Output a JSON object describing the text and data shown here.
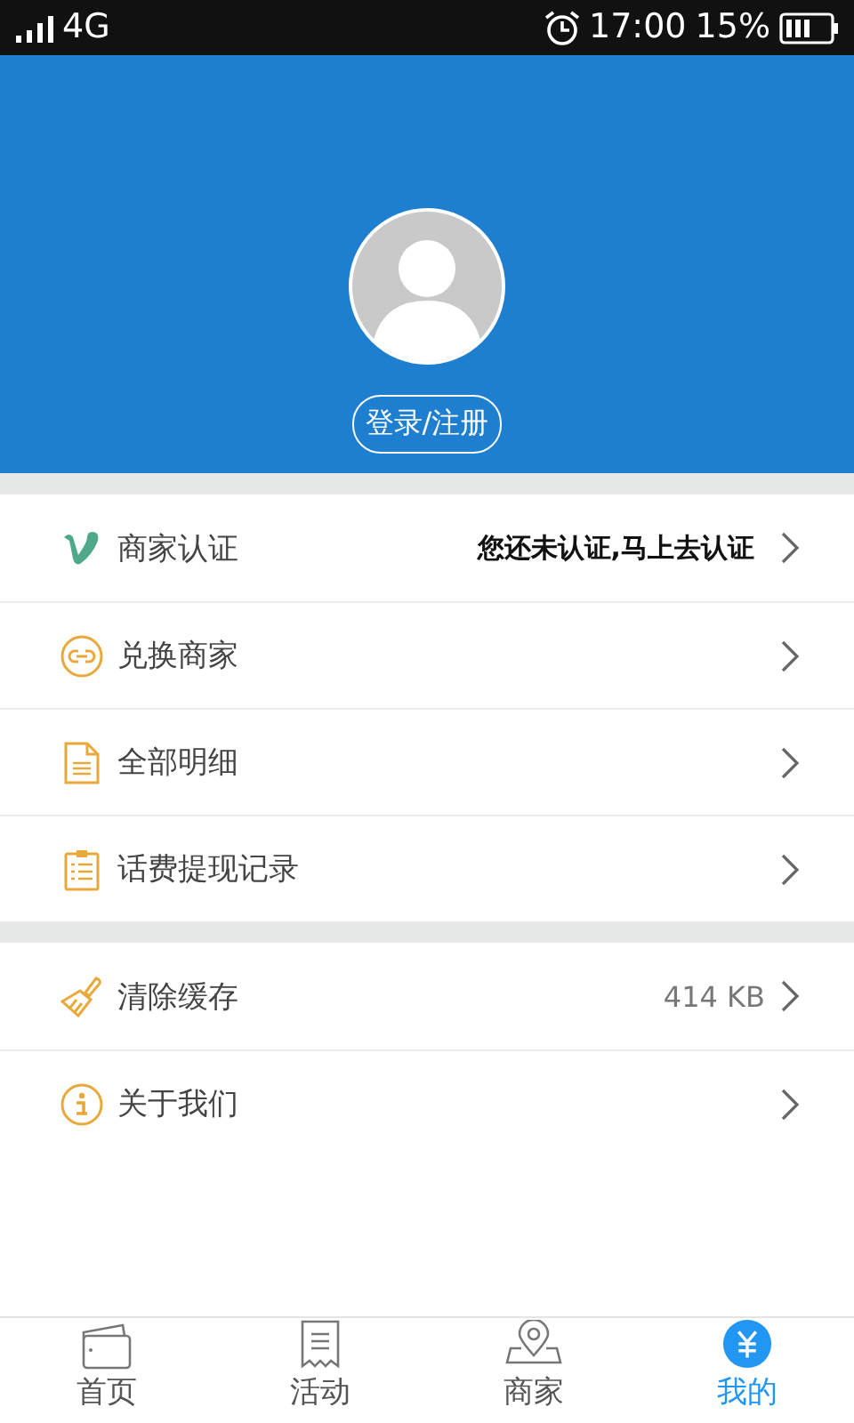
{
  "status_bar": {
    "network": "4G",
    "time": "17:00",
    "battery": "15%"
  },
  "profile": {
    "login_button": "登录/注册"
  },
  "menu_groups": [
    [
      {
        "kind": "verify",
        "label": "商家认证",
        "value": "您还未认证,马上去认证",
        "value_emphasis": true
      },
      {
        "kind": "exchange",
        "label": "兑换商家"
      },
      {
        "kind": "details",
        "label": "全部明细"
      },
      {
        "kind": "records",
        "label": "话费提现记录"
      }
    ],
    [
      {
        "kind": "cache",
        "label": "清除缓存",
        "value": "414 KB",
        "value_emphasis": false
      },
      {
        "kind": "about",
        "label": "关于我们"
      }
    ]
  ],
  "tabs": [
    {
      "kind": "home",
      "label": "首页",
      "selected": false
    },
    {
      "kind": "activity",
      "label": "活动",
      "selected": false
    },
    {
      "kind": "merchant",
      "label": "商家",
      "selected": false
    },
    {
      "kind": "mine",
      "label": "我的",
      "selected": true
    }
  ]
}
